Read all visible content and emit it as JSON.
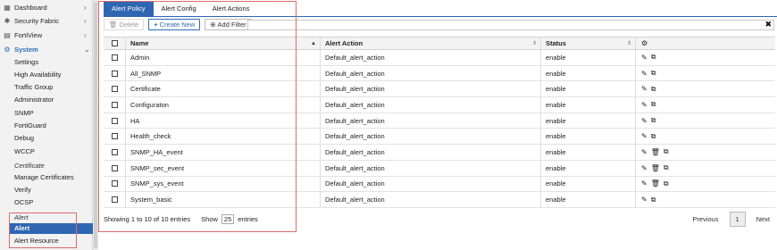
{
  "sidebar": {
    "top_items": [
      {
        "label": "Dashboard",
        "icon": "dashboard-icon"
      },
      {
        "label": "Security Fabric",
        "icon": "shield-icon"
      },
      {
        "label": "FortiView",
        "icon": "chart-icon"
      },
      {
        "label": "System",
        "icon": "gear-icon"
      }
    ],
    "system_items": [
      "Settings",
      "High Availability",
      "Traffic Group",
      "Administrator",
      "SNMP",
      "FortiGuard",
      "Debug",
      "WCCP"
    ],
    "certificate_header": "Certificate",
    "certificate_items": [
      "Manage Certificates",
      "Verify",
      "OCSP"
    ],
    "alert_header": "Alert",
    "alert_items": [
      "Alert",
      "Alert Resource"
    ]
  },
  "tabs": [
    "Alert Policy",
    "Alert Config",
    "Alert Actions"
  ],
  "toolbar": {
    "delete_label": "Delete",
    "create_label": "Create New",
    "filter_label": "Add Filter"
  },
  "table": {
    "columns": [
      "Name",
      "Alert Action",
      "Status"
    ],
    "rows": [
      {
        "name": "Admin",
        "action": "Default_alert_action",
        "status": "enable",
        "deletable": false
      },
      {
        "name": "All_SNMP",
        "action": "Default_alert_action",
        "status": "enable",
        "deletable": false
      },
      {
        "name": "Certificate",
        "action": "Default_alert_action",
        "status": "enable",
        "deletable": false
      },
      {
        "name": "Configuraton",
        "action": "Default_alert_action",
        "status": "enable",
        "deletable": false
      },
      {
        "name": "HA",
        "action": "Default_alert_action",
        "status": "enable",
        "deletable": false
      },
      {
        "name": "Health_check",
        "action": "Default_alert_action",
        "status": "enable",
        "deletable": false
      },
      {
        "name": "SNMP_HA_event",
        "action": "Default_alert_action",
        "status": "enable",
        "deletable": true
      },
      {
        "name": "SNMP_sec_event",
        "action": "Default_alert_action",
        "status": "enable",
        "deletable": true
      },
      {
        "name": "SNMP_sys_event",
        "action": "Default_alert_action",
        "status": "enable",
        "deletable": true
      },
      {
        "name": "System_basic",
        "action": "Default_alert_action",
        "status": "enable",
        "deletable": false
      }
    ]
  },
  "footer": {
    "showing": "Showing 1 to 10 of 10 entries",
    "show_label": "Show",
    "show_value": "25",
    "entries_label": "entries",
    "previous": "Previous",
    "page": "1",
    "next": "Next"
  },
  "colors": {
    "accent": "#2f66b2",
    "highlight": "#e06a6a"
  }
}
